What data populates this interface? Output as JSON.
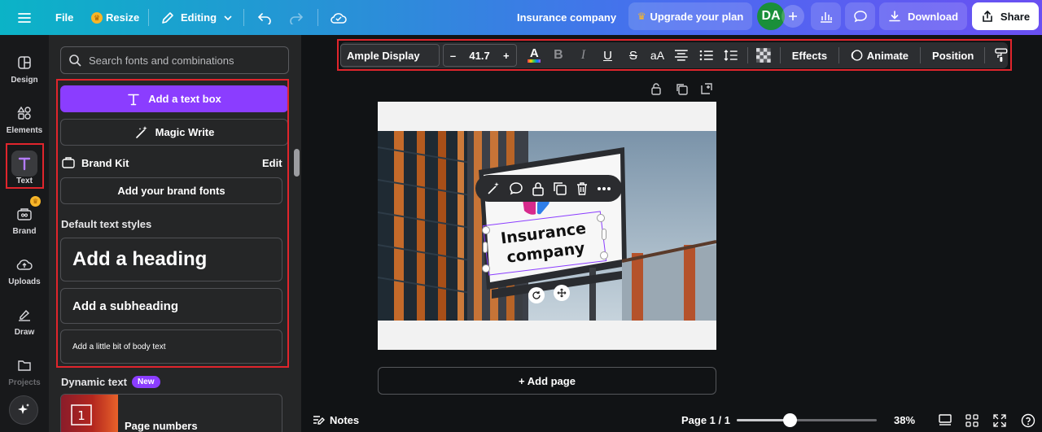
{
  "topbar": {
    "file": "File",
    "resize": "Resize",
    "editing": "Editing",
    "doc_title": "Insurance company",
    "upgrade": "Upgrade your plan",
    "avatar": "DA",
    "download": "Download",
    "share": "Share"
  },
  "rail": {
    "items": [
      {
        "label": "Design",
        "icon": "design-icon"
      },
      {
        "label": "Elements",
        "icon": "elements-icon"
      },
      {
        "label": "Text",
        "icon": "text-icon"
      },
      {
        "label": "Brand",
        "icon": "brand-icon"
      },
      {
        "label": "Uploads",
        "icon": "uploads-icon"
      },
      {
        "label": "Draw",
        "icon": "draw-icon"
      },
      {
        "label": "Projects",
        "icon": "projects-icon"
      }
    ]
  },
  "panel": {
    "search_placeholder": "Search fonts and combinations",
    "add_textbox": "Add a text box",
    "magic_write": "Magic Write",
    "brand_kit": "Brand Kit",
    "edit": "Edit",
    "add_brand_fonts": "Add your brand fonts",
    "default_styles": "Default text styles",
    "heading": "Add a heading",
    "subheading": "Add a subheading",
    "body": "Add a little bit of body text",
    "dynamic_text": "Dynamic text",
    "new_badge": "New",
    "page_numbers": "Page numbers"
  },
  "format_toolbar": {
    "font": "Ample Display",
    "font_size": "41.7",
    "minus": "–",
    "plus": "+",
    "case": "aA",
    "effects": "Effects",
    "animate": "Animate",
    "position": "Position"
  },
  "canvas": {
    "text_line1": "Insurance",
    "text_line2": "company",
    "add_page": "+ Add page"
  },
  "bottombar": {
    "notes": "Notes",
    "page": "Page 1 / 1",
    "zoom": "38%",
    "zoom_level": 0.38
  },
  "colors": {
    "accent": "#8b3dff",
    "highlight": "#e0252c",
    "avatar_bg": "#1a8f3a"
  }
}
